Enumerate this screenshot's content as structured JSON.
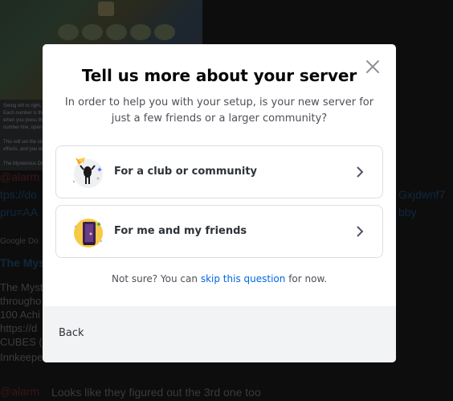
{
  "background": {
    "lines": [
      {
        "text": "@alarm",
        "kind": "mention"
      },
      {
        "text": "tps://do",
        "kind": "link"
      },
      {
        "text": "pru=AA",
        "kind": "link"
      },
      {
        "text": "Google Do",
        "kind": "small"
      },
      {
        "text": "The Myst",
        "kind": "title"
      },
      {
        "text": "The Myst",
        "kind": "text"
      },
      {
        "text": "througho",
        "kind": "text"
      },
      {
        "text": "100 Achi",
        "kind": "text"
      },
      {
        "text": "https://d",
        "kind": "text"
      },
      {
        "text": "CUBES (V",
        "kind": "text"
      },
      {
        "text": "Innkeepe",
        "kind": "text"
      }
    ],
    "right_links": [
      "Gxjdwnf7",
      "bby"
    ],
    "bottom_mention": "@alarm",
    "bottom_message": "Looks like they figured out the 3rd one too"
  },
  "modal": {
    "title": "Tell us more about your server",
    "subtitle": "In order to help you with your setup, is your new server for just a few friends or a larger community?",
    "options": [
      {
        "label": "For a club or community",
        "icon": "club-community-icon"
      },
      {
        "label": "For me and my friends",
        "icon": "friends-icon"
      }
    ],
    "not_sure_prefix": "Not sure? You can",
    "skip_link": "skip this question",
    "not_sure_suffix": "for now.",
    "back_label": "Back",
    "colors": {
      "link": "#0068e0",
      "title": "#060607",
      "footer": "#f2f3f5"
    }
  }
}
